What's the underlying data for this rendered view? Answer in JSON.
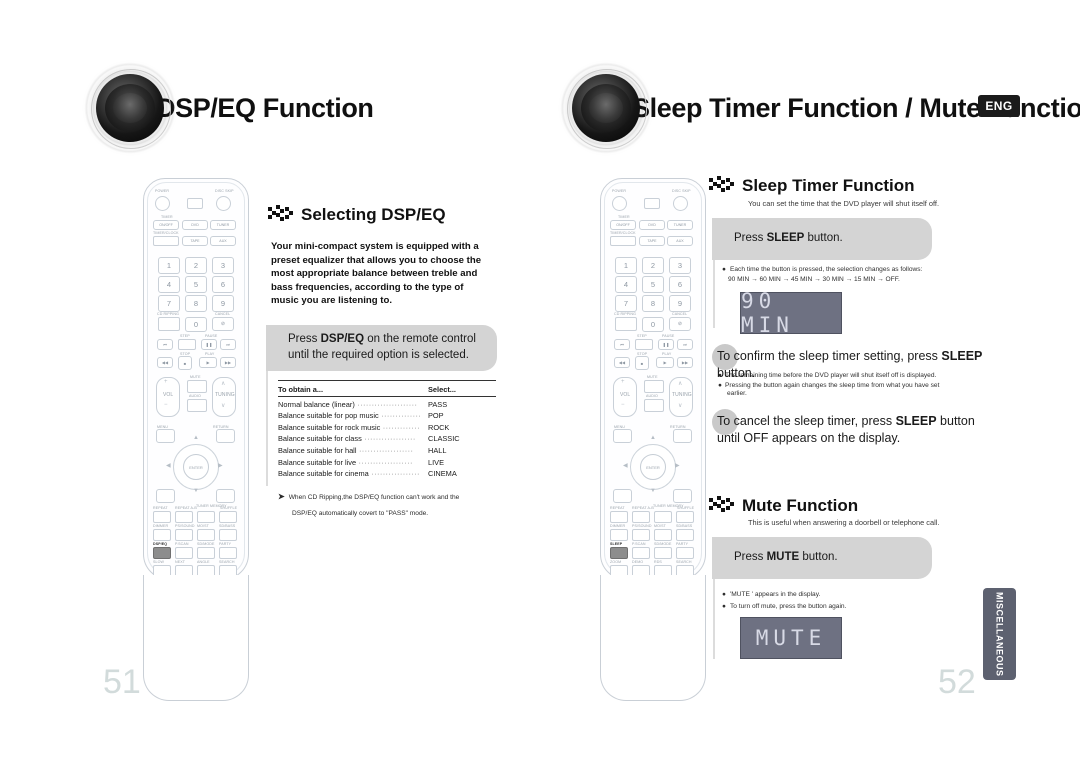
{
  "left_page": {
    "header_title": "DSP/EQ Function",
    "page_number": "51",
    "section": {
      "title": "Selecting DSP/EQ",
      "intro": "Your mini-compact system is equipped with a preset equalizer that allows you to choose the most appropriate balance between treble and bass frequencies, according to the type of music you are listening to.",
      "press_box": {
        "prefix": "Press ",
        "strong": "DSP/EQ",
        "suffix": " on the remote control until the required option is selected."
      },
      "table": {
        "headers": [
          "To obtain a...",
          "Select..."
        ],
        "rows": [
          {
            "obtain": "Normal balance (linear)",
            "select": "PASS"
          },
          {
            "obtain": "Balance suitable for pop music",
            "select": "POP"
          },
          {
            "obtain": "Balance suitable for rock music",
            "select": "ROCK"
          },
          {
            "obtain": "Balance suitable for class",
            "select": "CLASSIC"
          },
          {
            "obtain": "Balance suitable for hall",
            "select": "HALL"
          },
          {
            "obtain": "Balance suitable for live",
            "select": "LIVE"
          },
          {
            "obtain": "Balance suitable for cinema",
            "select": "CINEMA"
          }
        ]
      },
      "note_line1": "When CD Ripping,the DSP/EQ function can't work and the",
      "note_line2": "DSP/EQ automatically covert to \"PASS\" mode."
    },
    "remote": {
      "highlighted_button": "DSP/EQ"
    }
  },
  "right_page": {
    "header_title": "Sleep Timer Function / Mute Function",
    "lang_badge": "ENG",
    "page_number": "52",
    "side_tab": "MISCELLANEOUS",
    "sleep": {
      "title": "Sleep Timer Function",
      "subtitle": "You can set the time that the DVD player will shut itself off.",
      "press_box": {
        "prefix": "Press ",
        "strong": "SLEEP",
        "suffix": " button."
      },
      "bullets_1": [
        "Each time the button is pressed, the selection changes as follows:",
        "90 MIN → 60 MIN → 45 MIN → 30 MIN → 15 MIN → OFF."
      ],
      "lcd_1": "90 MIN",
      "step_confirm": {
        "prefix": "To confirm the sleep timer setting, press ",
        "strong": "SLEEP",
        "suffix": " button."
      },
      "bullets_2": [
        "The remaining time before the DVD player will shut itself off is displayed.",
        "Pressing the button again changes the sleep time from what you have set",
        "earlier."
      ],
      "step_cancel": {
        "prefix": "To cancel the sleep timer, press ",
        "strong": "SLEEP",
        "suffix": " button until OFF appears on the display."
      }
    },
    "mute": {
      "title": "Mute Function",
      "subtitle": "This is useful when answering a doorbell or telephone call.",
      "press_box": {
        "prefix": "Press ",
        "strong": "MUTE",
        "suffix": " button."
      },
      "bullets": [
        "'MUTE ' appears in the display.",
        "To turn off mute, press the button again."
      ],
      "lcd": "MUTE"
    },
    "remote": {
      "highlighted_button": "SLEEP"
    }
  },
  "remote_keys": {
    "power": "POWER",
    "disc_skip": "DISC SKIP",
    "timer": "TIMER",
    "on_off": "ON/OFF",
    "timer_clock": "TIMER/CLOCK",
    "dvd": "DVD",
    "tuner": "TUNER",
    "tape": "TAPE",
    "aux": "AUX",
    "numbers": [
      "1",
      "2",
      "3",
      "4",
      "5",
      "6",
      "7",
      "8",
      "9",
      "0"
    ],
    "cd_ripping": "CD RIPPING",
    "cancel": "CANCEL",
    "step": "STEP",
    "pause": "PAUSE",
    "stop": "STOP",
    "play": "PLAY",
    "vol": "VOL",
    "mute": "MUTE",
    "audio": "AUDIO",
    "tuning": "TUNING",
    "menu": "MENU",
    "return": "RETURN",
    "enter": "ENTER",
    "repeat": "REPEAT",
    "repeat_ab": "REPEAT A-B",
    "tuner_memory": "TUNER MEMORY",
    "shuffle": "SHUFFLE",
    "dimmer": "DIMMER",
    "p_scan": "P.SCAN",
    "sd_mode": "SD/MODE",
    "party": "PARTY",
    "dsp_eq": "DSP/EQ",
    "sleep": "SLEEP",
    "ps_sound": "PS/SOUND",
    "mo_st": "MO/ST",
    "sd_bass": "SD/BASS",
    "slow": "SLOW",
    "next": "NEXT",
    "angle": "ANGLE",
    "search": "SEARCH",
    "zoom": "ZOOM",
    "demo": "DEMO",
    "rds": "RDS"
  },
  "colors": {
    "header_text": "#101010",
    "grey_box": "#d4d4d4",
    "lcd_bg": "#6e7182",
    "lcd_text": "#d8dae6",
    "side_tab": "#5d6170",
    "page_number": "#d2dbdb",
    "badge_bg": "#1b1b1b"
  }
}
